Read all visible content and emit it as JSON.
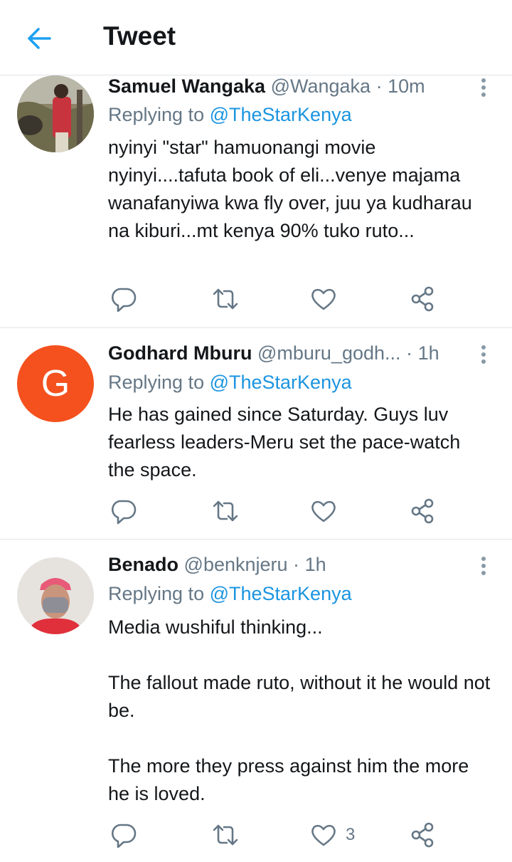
{
  "header": {
    "title": "Tweet"
  },
  "tweets": [
    {
      "name": "Samuel Wangaka",
      "handle": "@Wangaka",
      "separator": "·",
      "time": "10m",
      "replying_prefix": "Replying to ",
      "replying_to": "@TheStarKenya",
      "body": [
        "nyinyi \"star\" hamuonangi movie nyinyi....tafuta book of eli...venye majama wanafanyiwa kwa fly over, juu ya kudharau na kiburi...mt kenya 90% tuko ruto..."
      ],
      "avatar": {
        "type": "photo",
        "bg": "#8a7f66"
      }
    },
    {
      "name": "Godhard Mburu",
      "handle": "@mburu_godh...",
      "separator": "·",
      "time": "1h",
      "replying_prefix": "Replying to ",
      "replying_to": "@TheStarKenya",
      "body": [
        "He has gained since Saturday. Guys luv fearless leaders-Meru set the pace-watch the space."
      ],
      "avatar": {
        "type": "letter",
        "letter": "G",
        "bg": "#f4511e"
      }
    },
    {
      "name": "Benado",
      "handle": "@benknjeru",
      "separator": "·",
      "time": "1h",
      "replying_prefix": "Replying to ",
      "replying_to": "@TheStarKenya",
      "body": [
        "Media wushiful thinking...",
        "The fallout made ruto, without it he would not be.",
        "The more they press against him the more he is loved."
      ],
      "like_count": "3",
      "avatar": {
        "type": "photo",
        "bg": "#e8e6e2"
      }
    }
  ],
  "icons": {
    "back": "back-arrow-icon",
    "more": "more-vertical-icon",
    "reply": "reply-icon",
    "retweet": "retweet-icon",
    "like": "heart-icon",
    "share": "share-icon"
  },
  "colors": {
    "accent": "#1da1f2",
    "mention": "#1b95e0",
    "secondary_text": "#657786",
    "primary_text": "#14171a",
    "divider": "#dfe3e7"
  }
}
